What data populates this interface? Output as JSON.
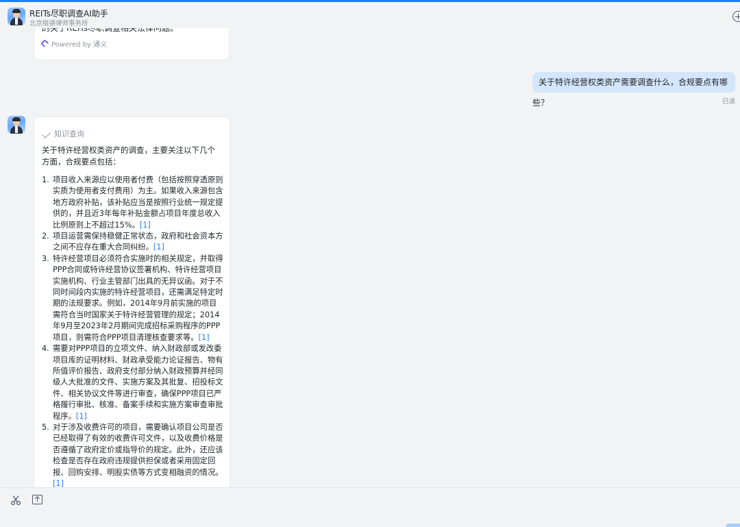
{
  "header": {
    "title": "REITs尽职调查AI助手",
    "subtitle": "北京植德律师事务所",
    "new_chat_icon": "plus-circle-icon"
  },
  "messages": {
    "previous_bot_tail": "的关于REITs尽职调查相关法律问题。",
    "powered_by": "Powered by 通义",
    "user_question": "关于特许经营权类资产需要调查什么，合规要点有哪些？",
    "read_status": "已读",
    "bot_answer": {
      "tool_label": "知识查询",
      "intro": "关于特许经营权类资产的调查，主要关注以下几个方面，合规要点包括：",
      "items": [
        {
          "num": "1.",
          "text": "项目收入来源应以使用者付费（包括按照穿透原则实质为使用者支付费用）为主。如果收入来源包含地方政府补贴，该补贴应当是按照行业统一规定提供的，并且近3年每年补贴金额占项目年度总收入比例原则上不超过15%。",
          "ref": "[1]"
        },
        {
          "num": "2.",
          "text": "项目运营需保持稳健正常状态，政府和社会资本方之间不应存在重大合同纠纷。",
          "ref": "[1]"
        },
        {
          "num": "3.",
          "text": "特许经营项目必须符合实施时的相关规定，并取得PPP合同或特许经营协议签署机构、特许经营项目实施机构、行业主管部门出具的无异议函。对于不同时间段内实施的特许经营项目，还需满足特定时期的法规要求。例如，2014年9月前实施的项目需符合当时国家关于特许经营管理的规定；2014年9月至2023年2月期间完成招标采购程序的PPP项目，则需符合PPP项目清理核查要求等。",
          "ref": "[1]"
        },
        {
          "num": "4.",
          "text": "需要对PPP项目的立项文件、纳入财政部或发改委项目库的证明材料、财政承受能力论证报告、物有所值评价报告、政府支付部分纳入财政预算并经同级人大批准的文件、实施方案及其批复、招投标文件、相关协议文件等进行审查，确保PPP项目已严格履行审批、核准、备案手续和实施方案审查审批程序。",
          "ref": "[1]"
        },
        {
          "num": "5.",
          "text": "对于涉及收费许可的项目，需要确认项目公司是否已经取得了有效的收费许可文件，以及收费价格是否遵循了政府定价或指导价的规定。此外，还应该检查是否存在政府违规提供担保或者采用固定回报、回购安排、明股实债等方式变相融资的情况。",
          "ref": "[1]"
        }
      ]
    }
  },
  "toolbar": {
    "screenshot_icon": "scissors-icon",
    "upload_icon": "upload-icon"
  },
  "colors": {
    "accent": "#1e80ff",
    "user_bubble": "#d4e6fb",
    "background": "#f2f3f5"
  }
}
